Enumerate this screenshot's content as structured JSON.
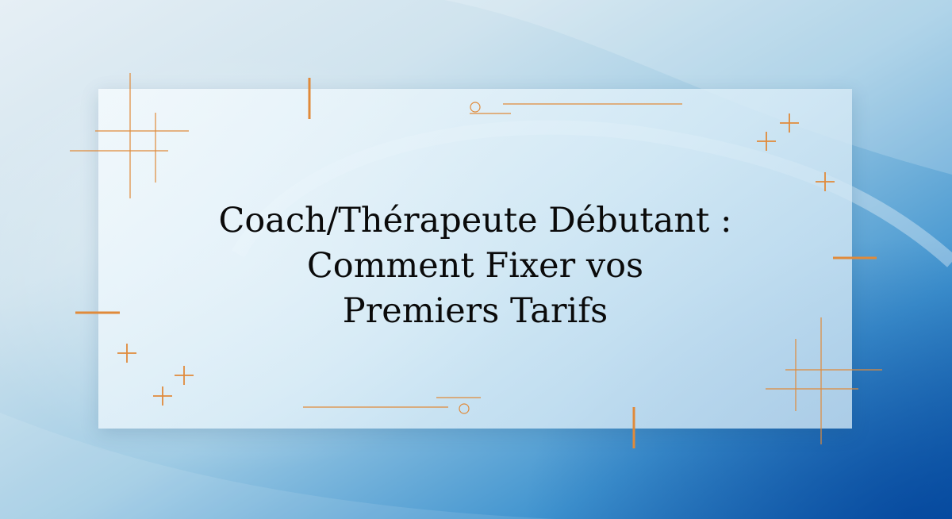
{
  "title": {
    "line1": "Coach/Thérapeute Débutant :",
    "line2": "Comment Fixer vos",
    "line3": "Premiers Tarifs"
  },
  "colors": {
    "accent": "#e08a3a",
    "text": "#0a0a0a",
    "background_light": "#e6eff5",
    "background_dark": "#0b58a8"
  },
  "decorations": {
    "icons": [
      "sparkle-cross-icon",
      "circle-line-icon",
      "dash-icon"
    ]
  }
}
